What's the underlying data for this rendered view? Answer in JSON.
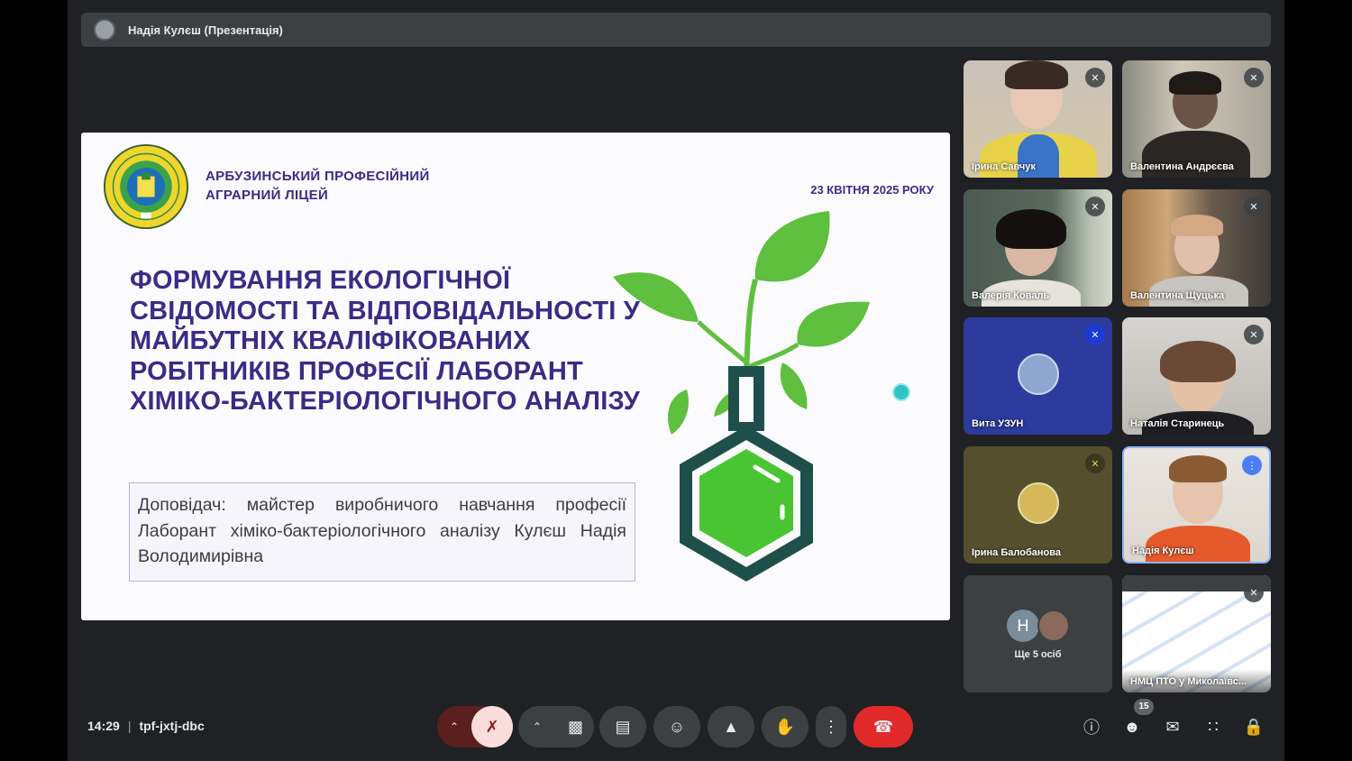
{
  "topbar": {
    "presenter": "Надія Кулєш (Презентація)"
  },
  "slide": {
    "school_line1": "АРБУЗИНСЬКИЙ ПРОФЕСІЙНИЙ",
    "school_line2": "АГРАРНИЙ ЛІЦЕЙ",
    "date": "23 КВІТНЯ 2025 РОКУ",
    "title": "ФОРМУВАННЯ ЕКОЛОГІЧНОЇ СВІДОМОСТІ ТА ВІДПОВІДАЛЬНОСТІ У МАЙБУТНІХ КВАЛІФІКОВАНИХ РОБІТНИКІВ ПРОФЕСІЇ ЛАБОРАНТ ХІМІКО-БАКТЕРІОЛОГІЧНОГО АНАЛІЗУ",
    "speaker": "Доповідач: майстер виробничого навчання професії Лаборант хіміко-бактеріологічного аналізу Кулєш Надія Володимирівна",
    "logo_icon": "lyceum-emblem",
    "accent_color": "#3a2c86",
    "leaf_color": "#5fbf3f"
  },
  "participants": [
    {
      "name": "Ірина Савчук",
      "muted": true
    },
    {
      "name": "Валентина Андрєєва",
      "muted": true
    },
    {
      "name": "Валерія Коваль",
      "muted": true
    },
    {
      "name": "Валентина Щуцька",
      "muted": true
    },
    {
      "name": "Вита УЗУН",
      "muted": true
    },
    {
      "name": "Наталія Старинець",
      "muted": true
    },
    {
      "name": "Ірина Балобанова",
      "muted": true
    },
    {
      "name": "Надія Кулєш",
      "muted": false,
      "speaking": true
    }
  ],
  "more_tile": {
    "initial": "Н",
    "text": "Ще 5 осіб"
  },
  "last_tile": {
    "name": "НМЦ ПТО у Миколаївс...",
    "muted": true
  },
  "bottombar": {
    "time": "14:29",
    "meeting_code": "tpf-jxtj-dbc",
    "people_count": "15"
  }
}
